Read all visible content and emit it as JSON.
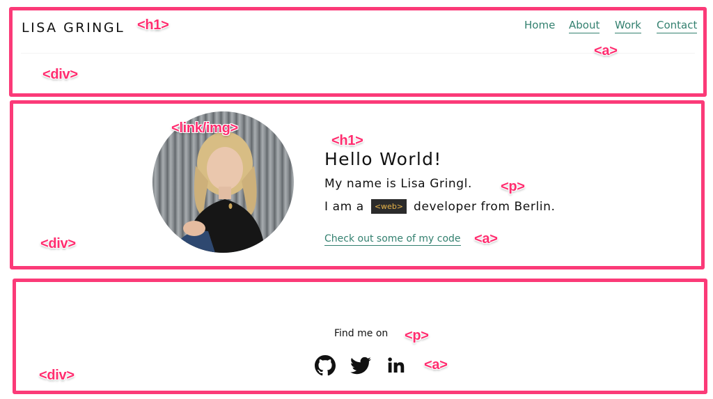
{
  "header": {
    "title": "LISA GRINGL",
    "nav": [
      {
        "label": "Home"
      },
      {
        "label": "About"
      },
      {
        "label": "Work"
      },
      {
        "label": "Contact"
      }
    ]
  },
  "hero": {
    "heading": "Hello World!",
    "intro_line1": "My name is Lisa Gringl.",
    "intro_line2_before": "I am a",
    "intro_tag": "<web>",
    "intro_line2_after": "developer from Berlin.",
    "code_link": "Check out some of my code"
  },
  "footer": {
    "find_me": "Find me on",
    "social": [
      {
        "icon": "github-icon"
      },
      {
        "icon": "twitter-icon"
      },
      {
        "icon": "linkedin-icon"
      }
    ]
  },
  "annotations": {
    "h1_header": "<h1>",
    "a_nav": "<a>",
    "div_header": "<div>",
    "link_img": "<link/img>",
    "h1_hero": "<h1>",
    "p_hero": "<p>",
    "a_hero": "<a>",
    "div_hero": "<div>",
    "p_footer": "<p>",
    "a_footer": "<a>",
    "div_footer": "<div>"
  },
  "colors": {
    "annotation_border": "#fb3a78",
    "link_green": "#33806f",
    "code_tag_bg": "#2b2b2b",
    "code_tag_text": "#e9b54a"
  }
}
